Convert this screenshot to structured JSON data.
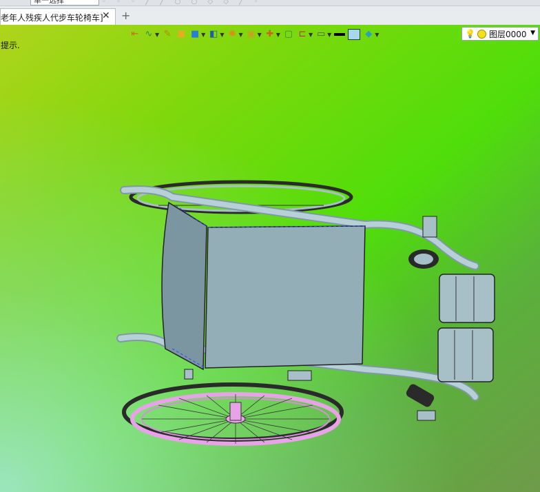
{
  "top": {
    "select_value": "单一选择"
  },
  "tab": {
    "title": "老年人残疾人代步车轮椅车]",
    "close": "✕",
    "add": "+"
  },
  "viewport": {
    "hint": "提示."
  },
  "toolbar": {
    "icons": [
      "exit-sketch-icon",
      "curve-icon",
      "pen-icon",
      "box-yellow-icon",
      "box-blue-icon",
      "box-split-icon",
      "wheel-icon",
      "mesh-icon",
      "axis-icon",
      "frame-icon",
      "dimension-icon",
      "display-icon",
      "line-style-icon",
      "color-swatch-icon",
      "layer-stack-icon"
    ],
    "line_color": "#000000",
    "fill_color": "#a6d8ec"
  },
  "layer": {
    "name": "图层0000"
  },
  "colors": {
    "frame": "#a7c0c8",
    "seat": "#94aeb8",
    "wheel": "#e8a3e8",
    "tire": "#2a2a2a"
  }
}
